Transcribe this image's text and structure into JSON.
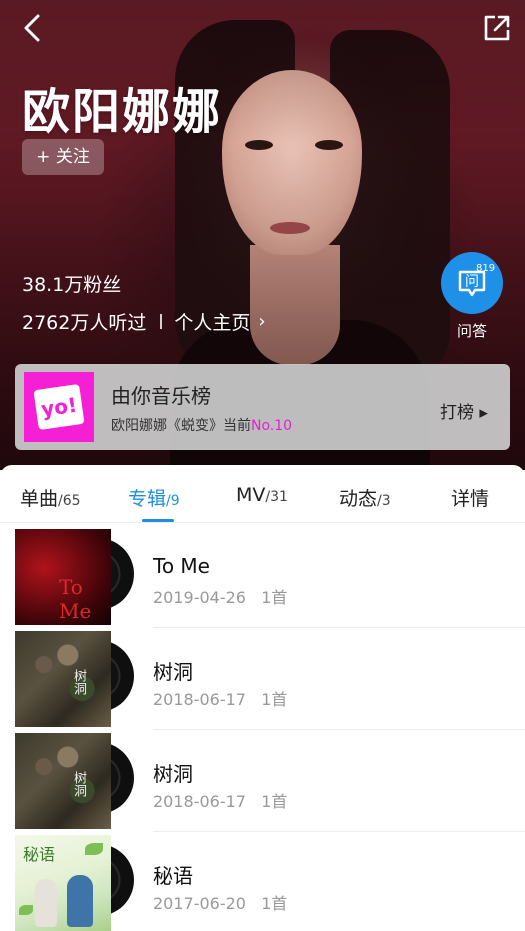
{
  "header": {
    "back_icon": "chevron-left-icon",
    "share_icon": "share-external-icon"
  },
  "artist": {
    "name": "欧阳娜娜",
    "follow_label": "+ 关注",
    "fans": "38.1万粉丝",
    "listens": "2762万人听过",
    "profile_link": "个人主页",
    "profile_chevron": "›"
  },
  "qa": {
    "icon_char": "问",
    "count": "819",
    "label": "问答"
  },
  "chart_banner": {
    "logo_text": "yo!",
    "title": "由你音乐榜",
    "subtitle_prefix": "欧阳娜娜《蜕变》当前",
    "rank": "No.10",
    "action": "打榜 ▸"
  },
  "tabs": [
    {
      "label": "单曲",
      "count": "/65",
      "active": false
    },
    {
      "label": "专辑",
      "count": "/9",
      "active": true
    },
    {
      "label": "MV",
      "count": "/31",
      "active": false
    },
    {
      "label": "动态",
      "count": "/3",
      "active": false
    },
    {
      "label": "详情",
      "count": "",
      "active": false
    }
  ],
  "albums": [
    {
      "title": "To Me",
      "date": "2019-04-26",
      "tracks": "1首",
      "cover_text": "To\nMe"
    },
    {
      "title": "树洞",
      "date": "2018-06-17",
      "tracks": "1首",
      "cover_text": "树洞"
    },
    {
      "title": "树洞",
      "date": "2018-06-17",
      "tracks": "1首",
      "cover_text": "树洞"
    },
    {
      "title": "秘语",
      "date": "2017-06-20",
      "tracks": "1首",
      "cover_text": "秘语"
    }
  ],
  "colors": {
    "accent": "#1e8fe0",
    "qa_button": "#1e90e8",
    "chart_magenta": "#f520d6",
    "hero_bg": "#5a1721"
  }
}
